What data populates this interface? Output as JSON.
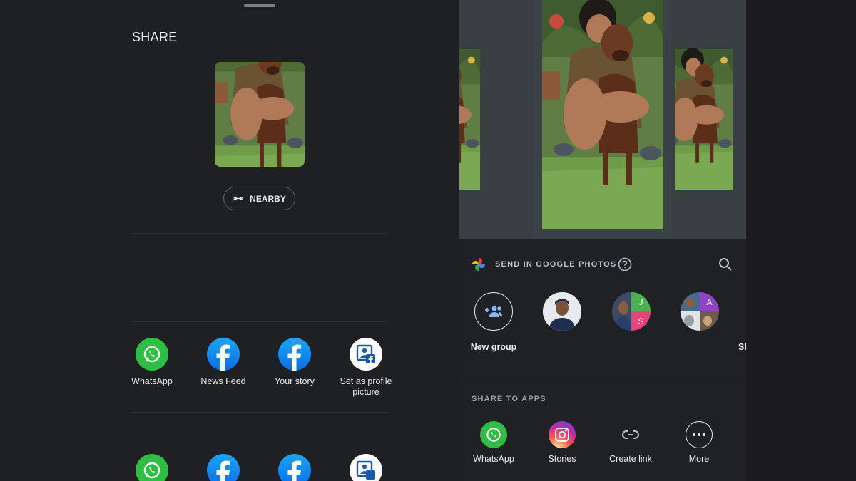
{
  "left_sheet": {
    "title": "SHARE",
    "nearby_label": "NEARBY",
    "apps_row1": [
      {
        "label": "WhatsApp",
        "icon": "whatsapp-icon"
      },
      {
        "label": "News Feed",
        "icon": "facebook-icon"
      },
      {
        "label": "Your story",
        "icon": "facebook-icon"
      },
      {
        "label": "Set as profile picture",
        "icon": "facebook-profile-icon"
      }
    ]
  },
  "right_sheet": {
    "send_label": "SEND IN GOOGLE PHOTOS",
    "contacts": [
      {
        "label": "New group",
        "icon": "add-group-icon"
      },
      {
        "label": ""
      },
      {
        "label": ""
      },
      {
        "label": ""
      },
      {
        "label": "Sh"
      }
    ],
    "group_initials": [
      "J",
      "S",
      "A"
    ],
    "share_to_apps_label": "SHARE TO APPS",
    "apps": [
      {
        "label": "WhatsApp",
        "icon": "whatsapp-icon"
      },
      {
        "label": "Stories",
        "icon": "instagram-icon"
      },
      {
        "label": "Create link",
        "icon": "link-icon"
      },
      {
        "label": "More",
        "icon": "more-icon"
      }
    ]
  },
  "colors": {
    "whatsapp": "#2fbe44",
    "facebook": "#1877f2",
    "background": "#1f2023"
  }
}
